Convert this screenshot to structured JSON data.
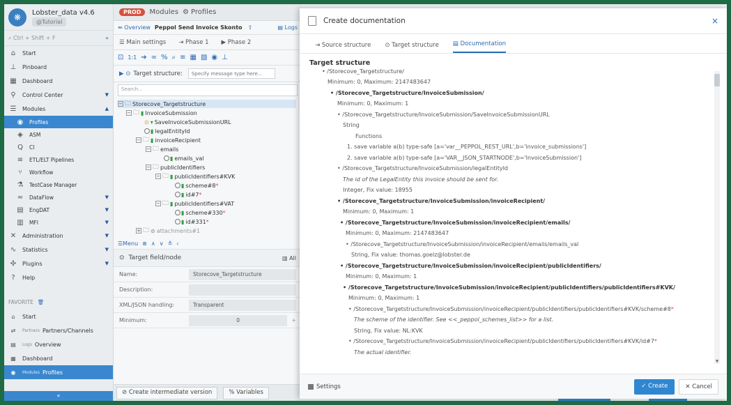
{
  "sidebar": {
    "app_name": "Lobster_data v4.6",
    "env_label": "@Tutorial",
    "search_shortcut": "Ctrl + Shift + F",
    "collapse_glyph": "«",
    "items": [
      {
        "label": "Start",
        "icon": "home-icon"
      },
      {
        "label": "Pinboard",
        "icon": "pin-icon"
      },
      {
        "label": "Dashboard",
        "icon": "dashboard-icon"
      },
      {
        "label": "Control Center",
        "icon": "control-icon"
      },
      {
        "label": "Modules",
        "icon": "modules-icon"
      }
    ],
    "subitems": [
      {
        "label": "Profiles",
        "active": true
      },
      {
        "label": "ASM"
      },
      {
        "label": "CI"
      },
      {
        "label": "ETL/ELT Pipelines"
      },
      {
        "label": "Workflow"
      },
      {
        "label": "TestCase Manager"
      },
      {
        "label": "DataFlow"
      },
      {
        "label": "EngDAT"
      },
      {
        "label": "MFI"
      }
    ],
    "items2": [
      {
        "label": "Administration"
      },
      {
        "label": "Statistics"
      },
      {
        "label": "Plugins"
      },
      {
        "label": "Help"
      }
    ],
    "favorites_label": "FAVORITE",
    "favorites": [
      {
        "prefix": "",
        "label": "Start"
      },
      {
        "prefix": "Partners",
        "label": "Partners/Channels"
      },
      {
        "prefix": "Logs",
        "label": "Overview"
      },
      {
        "prefix": "",
        "label": "Dashboard"
      },
      {
        "prefix": "Modules",
        "label": "Profiles",
        "active": true
      }
    ],
    "bottom_glyph": "«"
  },
  "middle": {
    "prod_badge": "PROD",
    "modules_label": "Modules",
    "profiles_label": "Profiles",
    "overview_label": "Overview",
    "page_title": "Peppol Send Invoice Skonto",
    "logs_label": "Logs",
    "main_settings": "Main settings",
    "phase1": "Phase 1",
    "phase2": "Phase 2",
    "target_structure_label": "Target structure:",
    "target_structure_placeholder": "Specify message type here...",
    "tree_search_placeholder": "Search...",
    "tree": [
      {
        "label": "Storecove_Targetstructure"
      },
      {
        "label": "InvoiceSubmission"
      },
      {
        "label": "SaveInvoiceSubmissionURL"
      },
      {
        "label": "legalEntityId"
      },
      {
        "label": "invoiceRecipient"
      },
      {
        "label": "emails"
      },
      {
        "label": "emails_val"
      },
      {
        "label": "publicIdentifiers"
      },
      {
        "label": "publicIdentifiers#KVK"
      },
      {
        "label": "scheme#8"
      },
      {
        "label": "id#7"
      },
      {
        "label": "publicIdentifiers#VAT"
      },
      {
        "label": "scheme#330"
      },
      {
        "label": "id#331"
      },
      {
        "label": "attachments#1"
      }
    ],
    "tree_menu_label": "Menu",
    "target_field_label": "Target field/node",
    "all_label": "All",
    "fields": [
      {
        "label": "Name:",
        "value": "Storecove_Targetstructure"
      },
      {
        "label": "Description:",
        "value": ""
      },
      {
        "label": "XML/JSON handling:",
        "value": "Transparent"
      },
      {
        "label": "Minimum:",
        "value": "0"
      }
    ],
    "btn_intermediate": "Create intermediate version",
    "btn_variables": "Variables"
  },
  "modal": {
    "title": "Create documentation",
    "close": "×",
    "tabs": [
      "Source structure",
      "Target structure",
      "Documentation"
    ],
    "section_title": "Target structure",
    "lines": [
      "/Storecove_Targetstructure/",
      "Minimum: 0, Maximum: 2147483647",
      "/Storecove_Targetstructure/InvoiceSubmission/",
      "Minimum: 0, Maximum: 1",
      "/Storecove_Targetstructure/InvoiceSubmission/SaveInvoiceSubmissionURL",
      "String",
      "Functions",
      "1. save variable a(b) type-safe [a='var__PEPPOL_REST_URL',b='invoice_submissions']",
      "2. save variable a(b) type-safe [a='VAR__JSON_STARTNODE',b='InvoiceSubmission']",
      "/Storecove_Targetstructure/InvoiceSubmission/legalEntityId",
      "The id of the LegalEntity this invoice should be sent for.",
      "Integer, Fix value: 18955",
      "/Storecove_Targetstructure/InvoiceSubmission/invoiceRecipient/",
      "Minimum: 0, Maximum: 1",
      "/Storecove_Targetstructure/InvoiceSubmission/invoiceRecipient/emails/",
      "Minimum: 0, Maximum: 2147483647",
      "/Storecove_Targetstructure/InvoiceSubmission/invoiceRecipient/emails/emails_val",
      "String, Fix value: thomas.goelz@lobster.de",
      "/Storecove_Targetstructure/InvoiceSubmission/invoiceRecipient/publicIdentifiers/",
      "Minimum: 0, Maximum: 1",
      "/Storecove_Targetstructure/InvoiceSubmission/invoiceRecipient/publicIdentifiers/publicIdentifiers#KVK/",
      "Minimum: 0, Maximum: 1",
      "/Storecove_Targetstructure/InvoiceSubmission/invoiceRecipient/publicIdentifiers/publicIdentifiers#KVK/scheme#8",
      "The scheme of the identifier. See <<_peppol_schemes_list>> for a list.",
      "String, Fix value: NL:KVK",
      "/Storecove_Targetstructure/InvoiceSubmission/invoiceRecipient/publicIdentifiers/publicIdentifiers#KVK/id#7",
      "The actual identifier."
    ],
    "settings_label": "Settings",
    "create_label": "Create",
    "cancel_label": "Cancel"
  },
  "colors": {
    "accent": "#2f86d1",
    "prod": "#d9503f",
    "frame": "#1f6b46"
  }
}
